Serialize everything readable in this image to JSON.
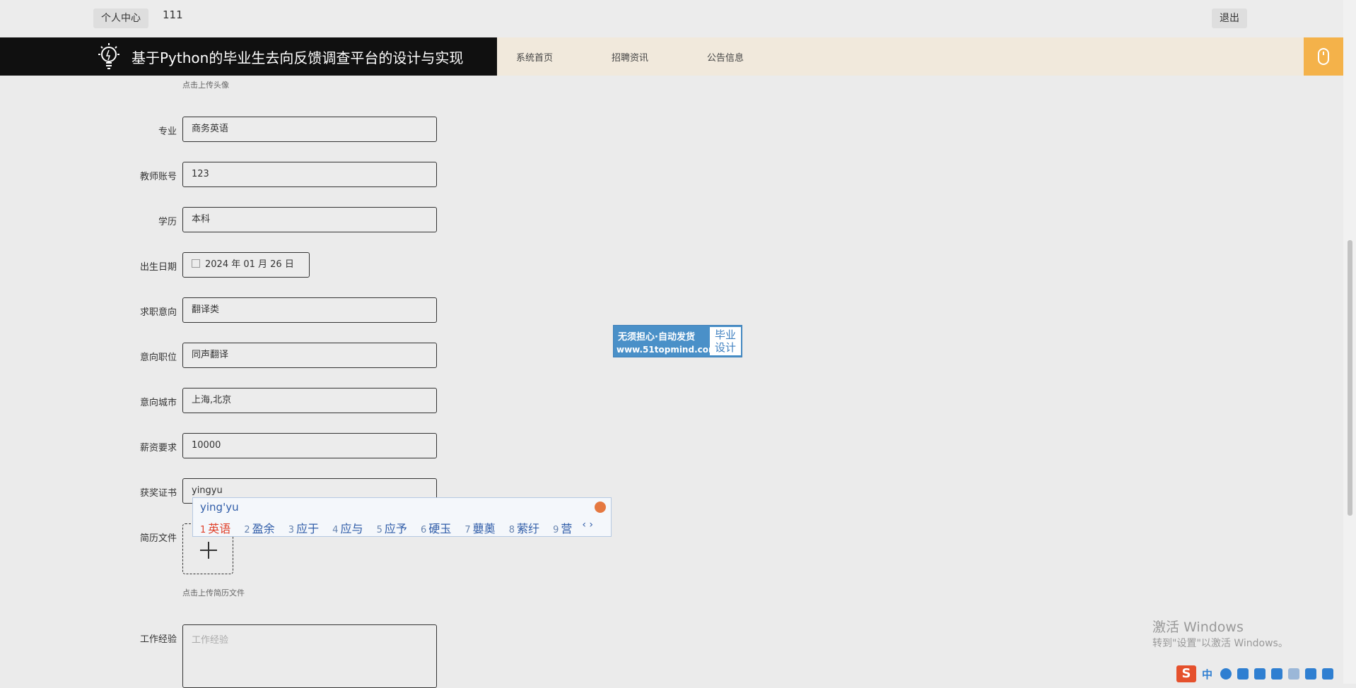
{
  "topbar": {
    "user_center": "个人中心",
    "username": "111",
    "logout": "退出"
  },
  "header": {
    "title": "基于Python的毕业生去向反馈调查平台的设计与实现",
    "nav": [
      "系统首页",
      "招聘资讯",
      "公告信息"
    ]
  },
  "form": {
    "avatar_hint": "点击上传头像",
    "major": {
      "label": "专业",
      "value": "商务英语"
    },
    "teacher_account": {
      "label": "教师账号",
      "value": "123"
    },
    "education": {
      "label": "学历",
      "value": "本科"
    },
    "birth_date": {
      "label": "出生日期",
      "value": "2024 年 01 月 26 日"
    },
    "job_intent": {
      "label": "求职意向",
      "value": "翻译类"
    },
    "position": {
      "label": "意向职位",
      "value": "同声翻译"
    },
    "city": {
      "label": "意向城市",
      "value": "上海,北京"
    },
    "salary": {
      "label": "薪资要求",
      "value": "10000"
    },
    "certificate": {
      "label": "获奖证书",
      "value": "yingyu"
    },
    "resume": {
      "label": "简历文件",
      "hint": "点击上传简历文件"
    },
    "experience": {
      "label": "工作经验",
      "placeholder": "工作经验"
    }
  },
  "ime": {
    "composition": "ying'yu",
    "candidates": [
      {
        "n": "1",
        "text": "英语"
      },
      {
        "n": "2",
        "text": "盈余"
      },
      {
        "n": "3",
        "text": "应于"
      },
      {
        "n": "4",
        "text": "应与"
      },
      {
        "n": "5",
        "text": "应予"
      },
      {
        "n": "6",
        "text": "硬玉"
      },
      {
        "n": "7",
        "text": "蘡薁"
      },
      {
        "n": "8",
        "text": "萦纡"
      },
      {
        "n": "9",
        "text": "营"
      }
    ],
    "arrows": "‹ ›"
  },
  "ad": {
    "line1": "无须担心·自动发货",
    "line2": "www.51topmind.com",
    "side1": "毕业",
    "side2": "设计"
  },
  "windows": {
    "line1": "激活 Windows",
    "line2": "转到\"设置\"以激活 Windows。"
  },
  "tray": {
    "sogou": "S",
    "lang": "中"
  },
  "colors": {
    "header_brand_bg": "#101010",
    "header_bg": "#f1e9dc",
    "accent": "#f4b24a",
    "ime_text": "#2f5ca8",
    "ime_first": "#e0412b"
  }
}
